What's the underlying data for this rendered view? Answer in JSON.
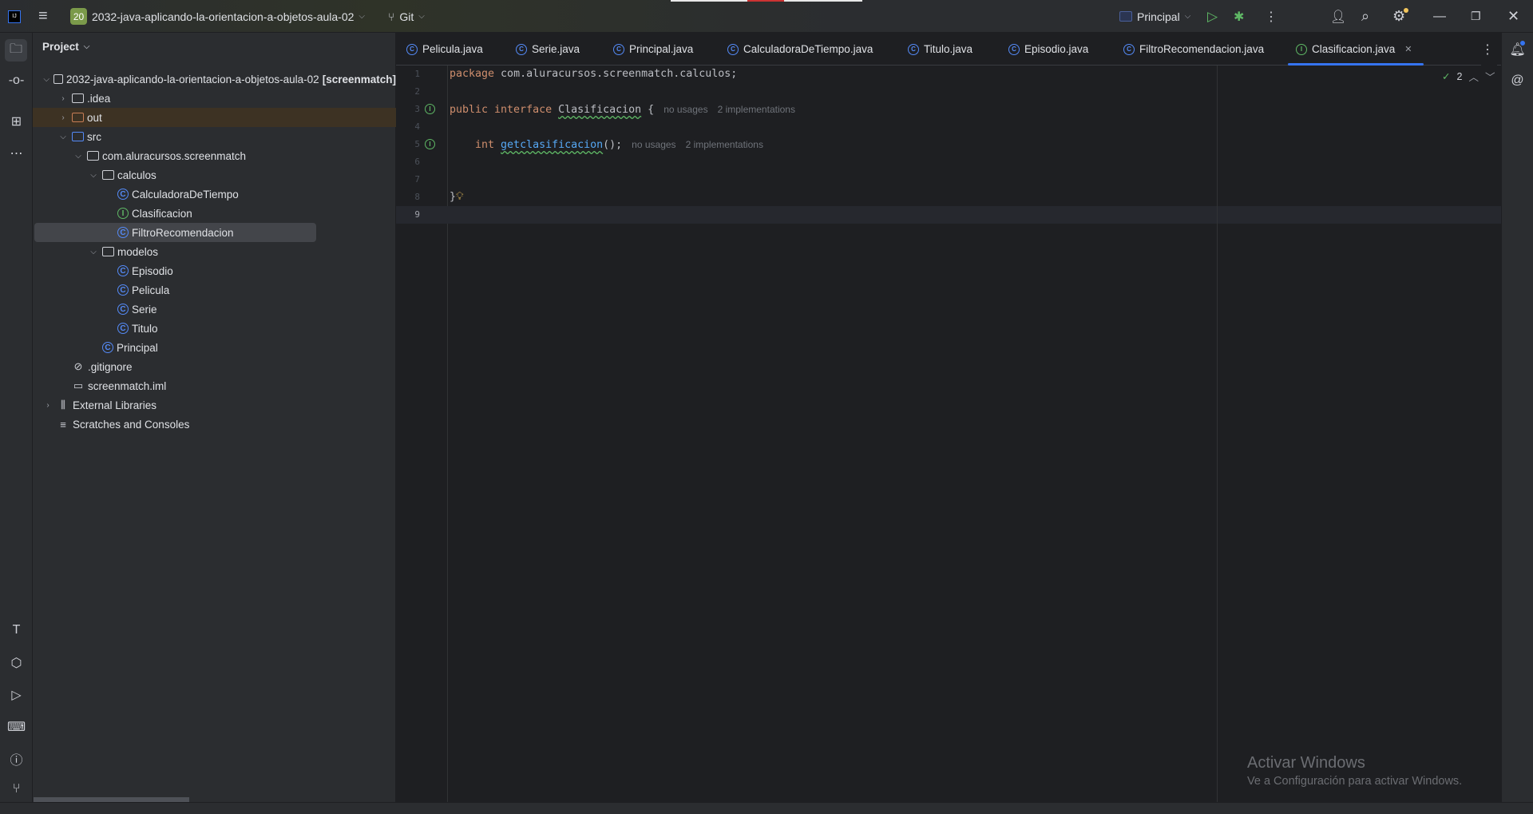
{
  "titlebar": {
    "project_badge": "20",
    "project_name": "2032-java-aplicando-la-orientacion-a-objetos-aula-02",
    "vcs": "Git",
    "run_config": "Principal"
  },
  "project_panel": {
    "title": "Project",
    "tree": [
      {
        "label": "2032-java-aplicando-la-orientacion-a-objetos-aula-02",
        "suffix": "[screenmatch]",
        "level": 0,
        "icon": "module-folder-icon",
        "expanded": true
      },
      {
        "label": ".idea",
        "level": 1,
        "icon": "folder-icon",
        "expanded": false
      },
      {
        "label": "out",
        "level": 1,
        "icon": "excluded-folder-icon",
        "expanded": false
      },
      {
        "label": "src",
        "level": 1,
        "icon": "source-folder-icon",
        "expanded": true
      },
      {
        "label": "com.aluracursos.screenmatch",
        "level": 2,
        "icon": "package-icon",
        "expanded": true
      },
      {
        "label": "calculos",
        "level": 3,
        "icon": "package-icon",
        "expanded": true
      },
      {
        "label": "CalculadoraDeTiempo",
        "level": 4,
        "icon": "class-icon"
      },
      {
        "label": "Clasificacion",
        "level": 4,
        "icon": "interface-icon"
      },
      {
        "label": "FiltroRecomendacion",
        "level": 4,
        "icon": "class-icon",
        "selected": true
      },
      {
        "label": "modelos",
        "level": 3,
        "icon": "package-icon",
        "expanded": true
      },
      {
        "label": "Episodio",
        "level": 4,
        "icon": "class-icon"
      },
      {
        "label": "Pelicula",
        "level": 4,
        "icon": "class-icon"
      },
      {
        "label": "Serie",
        "level": 4,
        "icon": "class-icon"
      },
      {
        "label": "Titulo",
        "level": 4,
        "icon": "class-icon"
      },
      {
        "label": "Principal",
        "level": 3,
        "icon": "main-class-icon"
      },
      {
        "label": ".gitignore",
        "level": 1,
        "icon": "ignore-file-icon"
      },
      {
        "label": "screenmatch.iml",
        "level": 1,
        "icon": "iml-file-icon"
      },
      {
        "label": "External Libraries",
        "level": 0,
        "icon": "libraries-icon",
        "expanded": false
      },
      {
        "label": "Scratches and Consoles",
        "level": 0,
        "icon": "scratches-icon"
      }
    ]
  },
  "tabs": [
    {
      "label": "Pelicula.java",
      "icon": "class-icon"
    },
    {
      "label": "Serie.java",
      "icon": "class-icon"
    },
    {
      "label": "Principal.java",
      "icon": "main-class-icon"
    },
    {
      "label": "CalculadoraDeTiempo.java",
      "icon": "class-icon"
    },
    {
      "label": "Titulo.java",
      "icon": "class-icon"
    },
    {
      "label": "Episodio.java",
      "icon": "class-icon"
    },
    {
      "label": "FiltroRecomendacion.java",
      "icon": "class-icon"
    },
    {
      "label": "Clasificacion.java",
      "icon": "interface-icon",
      "active": true
    }
  ],
  "editor": {
    "inspections_count": "2",
    "line_numbers": [
      "1",
      "2",
      "3",
      "4",
      "5",
      "6",
      "7",
      "8",
      "9"
    ],
    "code": {
      "l1_kw": "package",
      "l1_rest": " com.aluracursos.screenmatch.calculos;",
      "l3_kw": "public interface ",
      "l3_name": "Clasificacion",
      "l3_rest": " {",
      "l3_hint1": "no usages",
      "l3_hint2": "2 implementations",
      "l5_kw": "    int ",
      "l5_name": "getclasificacion",
      "l5_rest": "();",
      "l5_hint1": "no usages",
      "l5_hint2": "2 implementations",
      "l8": "}"
    }
  },
  "watermark": {
    "title": "Activar Windows",
    "subtitle": "Ve a Configuración para activar Windows."
  },
  "colors": {
    "accent": "#3574f0",
    "class": "#548af7",
    "interface": "#5fb865",
    "keyword": "#cf8e6d",
    "function": "#56a8f5"
  }
}
